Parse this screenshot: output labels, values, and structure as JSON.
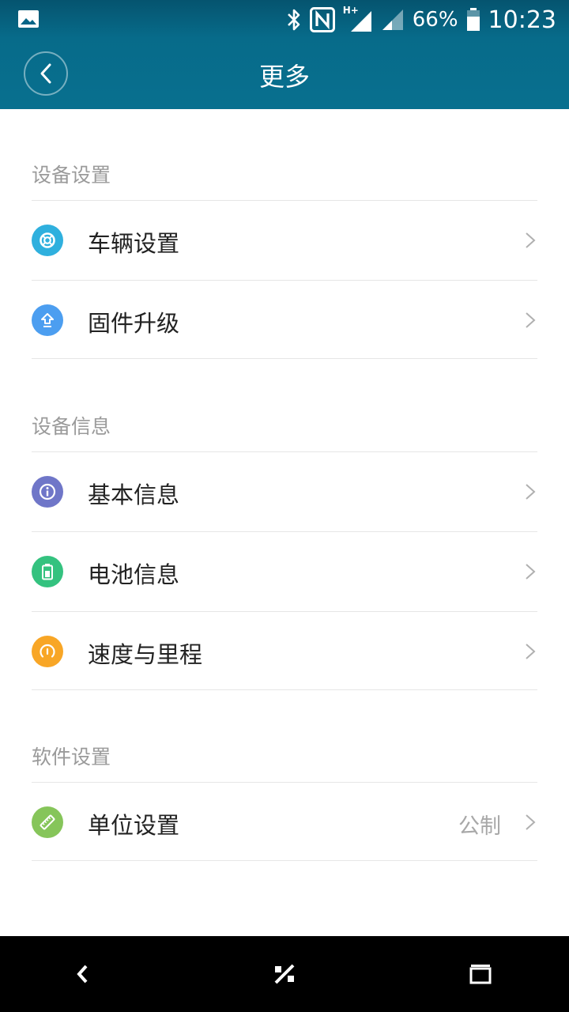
{
  "status_bar": {
    "battery_percent": "66%",
    "time": "10:23",
    "network_label": "H+",
    "icons": [
      "gallery-icon",
      "bluetooth-icon",
      "nfc-icon",
      "signal-icon",
      "signal-icon",
      "battery-icon"
    ]
  },
  "header": {
    "title": "更多",
    "back_icon": "chevron-left-icon"
  },
  "sections": [
    {
      "title": "设备设置",
      "items": [
        {
          "label": "车辆设置",
          "icon": "lifebuoy-icon",
          "color": "#2fb0de"
        },
        {
          "label": "固件升级",
          "icon": "upload-arrow-icon",
          "color": "#4c9ef0"
        }
      ]
    },
    {
      "title": "设备信息",
      "items": [
        {
          "label": "基本信息",
          "icon": "info-icon",
          "color": "#6f76c8"
        },
        {
          "label": "电池信息",
          "icon": "battery-icon",
          "color": "#34c27f"
        },
        {
          "label": "速度与里程",
          "icon": "speedometer-icon",
          "color": "#f8a626"
        }
      ]
    },
    {
      "title": "软件设置",
      "items": [
        {
          "label": "单位设置",
          "icon": "ruler-icon",
          "color": "#86c55a",
          "value": "公制"
        }
      ]
    }
  ],
  "nav_bar": {
    "icons": [
      "back-icon",
      "home-icon",
      "recents-icon"
    ]
  }
}
